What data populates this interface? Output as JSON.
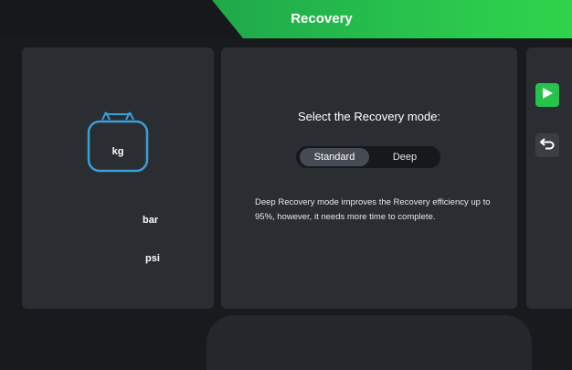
{
  "header": {
    "title": "Recovery"
  },
  "tank": {
    "unit_main": "kg",
    "unit_secondary_1": "bar",
    "unit_secondary_2": "psi"
  },
  "main": {
    "prompt": "Select the Recovery mode:",
    "modes": [
      {
        "label": "Standard",
        "selected": true
      },
      {
        "label": "Deep",
        "selected": false
      }
    ],
    "description": "Deep Recovery mode improves the Recovery efficiency up to 95%, however, it needs more time to complete."
  },
  "controls": {
    "start_icon": "play-icon",
    "back_icon": "return-icon"
  },
  "colors": {
    "accent": "#26c24b",
    "panel": "#2a2d31",
    "background": "#181a1d",
    "tank_outline": "#3aa0d8"
  }
}
